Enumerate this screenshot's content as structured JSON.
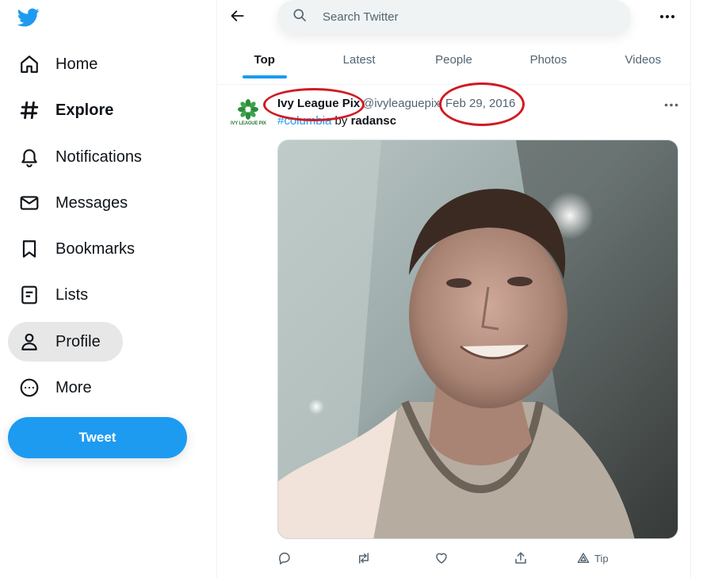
{
  "sidebar": {
    "logo_icon": "twitter-bird-icon",
    "items": [
      {
        "label": "Home",
        "icon": "home-icon"
      },
      {
        "label": "Explore",
        "icon": "hashtag-icon"
      },
      {
        "label": "Notifications",
        "icon": "bell-icon"
      },
      {
        "label": "Messages",
        "icon": "envelope-icon"
      },
      {
        "label": "Bookmarks",
        "icon": "bookmark-icon"
      },
      {
        "label": "Lists",
        "icon": "list-icon"
      },
      {
        "label": "Profile",
        "icon": "person-icon"
      },
      {
        "label": "More",
        "icon": "more-circle-icon"
      }
    ],
    "tweet_button": "Tweet"
  },
  "header": {
    "search_placeholder": "Search Twitter",
    "tabs": [
      {
        "label": "Top",
        "active": true
      },
      {
        "label": "Latest",
        "active": false
      },
      {
        "label": "People",
        "active": false
      },
      {
        "label": "Photos",
        "active": false
      },
      {
        "label": "Videos",
        "active": false
      }
    ]
  },
  "tweet": {
    "avatar_text": "IVY LEAGUE PIX",
    "display_name": "Ivy League Pix",
    "handle": "@ivyleaguepix",
    "separator": "·",
    "date": "Feb 29, 2016",
    "hashtag": "#columbia",
    "text_by": "by",
    "author": "radansc",
    "actions": {
      "tip_label": "Tip"
    }
  },
  "colors": {
    "brand": "#1d9bf0",
    "annotation": "#d11a22",
    "active_nav_bg": "#e7e7e8"
  }
}
